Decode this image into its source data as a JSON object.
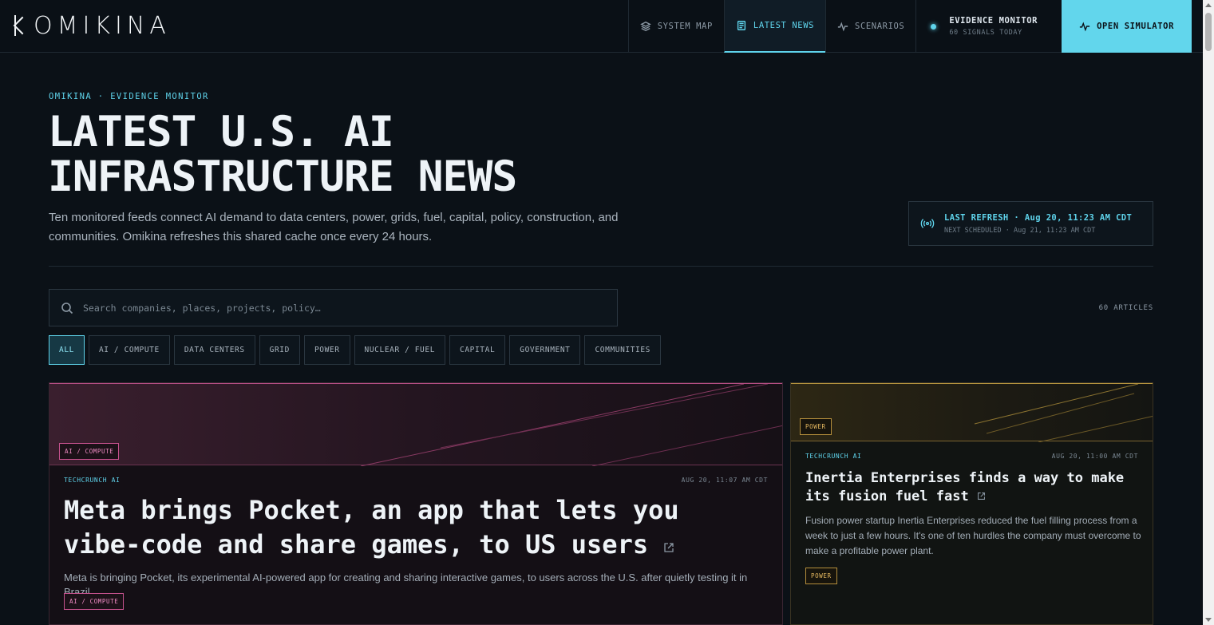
{
  "brand": {
    "name": "OMIKINA"
  },
  "nav": {
    "system_map": "SYSTEM MAP",
    "latest_news": "LATEST NEWS",
    "scenarios": "SCENARIOS",
    "monitor_title": "EVIDENCE MONITOR",
    "monitor_sub": "60 SIGNALS TODAY",
    "open_simulator": "OPEN SIMULATOR"
  },
  "hero": {
    "eyebrow": "OMIKINA · EVIDENCE MONITOR",
    "title_line1": "LATEST U.S. AI",
    "title_line2": "INFRASTRUCTURE NEWS",
    "description": "Ten monitored feeds connect AI demand to data centers, power, grids, fuel, capital, policy, construction, and communities. Omikina refreshes this shared cache once every 24 hours."
  },
  "refresh": {
    "last": "LAST REFRESH · Aug 20, 11:23 AM CDT",
    "next": "NEXT SCHEDULED · Aug 21, 11:23 AM CDT"
  },
  "search": {
    "placeholder": "Search companies, places, projects, policy…",
    "value": ""
  },
  "article_count": "60 ARTICLES",
  "filters": [
    "ALL",
    "AI / COMPUTE",
    "DATA CENTERS",
    "GRID",
    "POWER",
    "NUCLEAR / FUEL",
    "CAPITAL",
    "GOVERNMENT",
    "COMMUNITIES"
  ],
  "active_filter": "ALL",
  "articles": [
    {
      "category": "AI / COMPUTE",
      "source": "TECHCRUNCH AI",
      "date": "AUG 20, 11:07 AM CDT",
      "headline": "Meta brings Pocket, an app that lets you vibe-code and share games, to US users",
      "summary": "Meta is bringing Pocket, its experimental AI-powered app for creating and sharing interactive games, to users across the U.S. after quietly testing it in Brazil.",
      "tag": "AI / COMPUTE",
      "accent": "#c6528e"
    },
    {
      "category": "POWER",
      "source": "TECHCRUNCH AI",
      "date": "AUG 20, 11:00 AM CDT",
      "headline": "Inertia Enterprises finds a way to make its fusion fuel fast",
      "summary": "Fusion power startup Inertia Enterprises reduced the fuel filling process from a week to just a few hours. It's one of ten hurdles the company must overcome to make a profitable power plant.",
      "tag": "POWER",
      "accent": "#b48e3c"
    }
  ],
  "colors": {
    "accent": "#5fd4ec",
    "background": "#0b1117",
    "pink": "#c6528e",
    "gold": "#b48e3c"
  },
  "icons": [
    "layers-icon",
    "newspaper-icon",
    "pulse-icon",
    "status-dot-icon",
    "broadcast-icon",
    "search-icon",
    "external-link-icon"
  ]
}
